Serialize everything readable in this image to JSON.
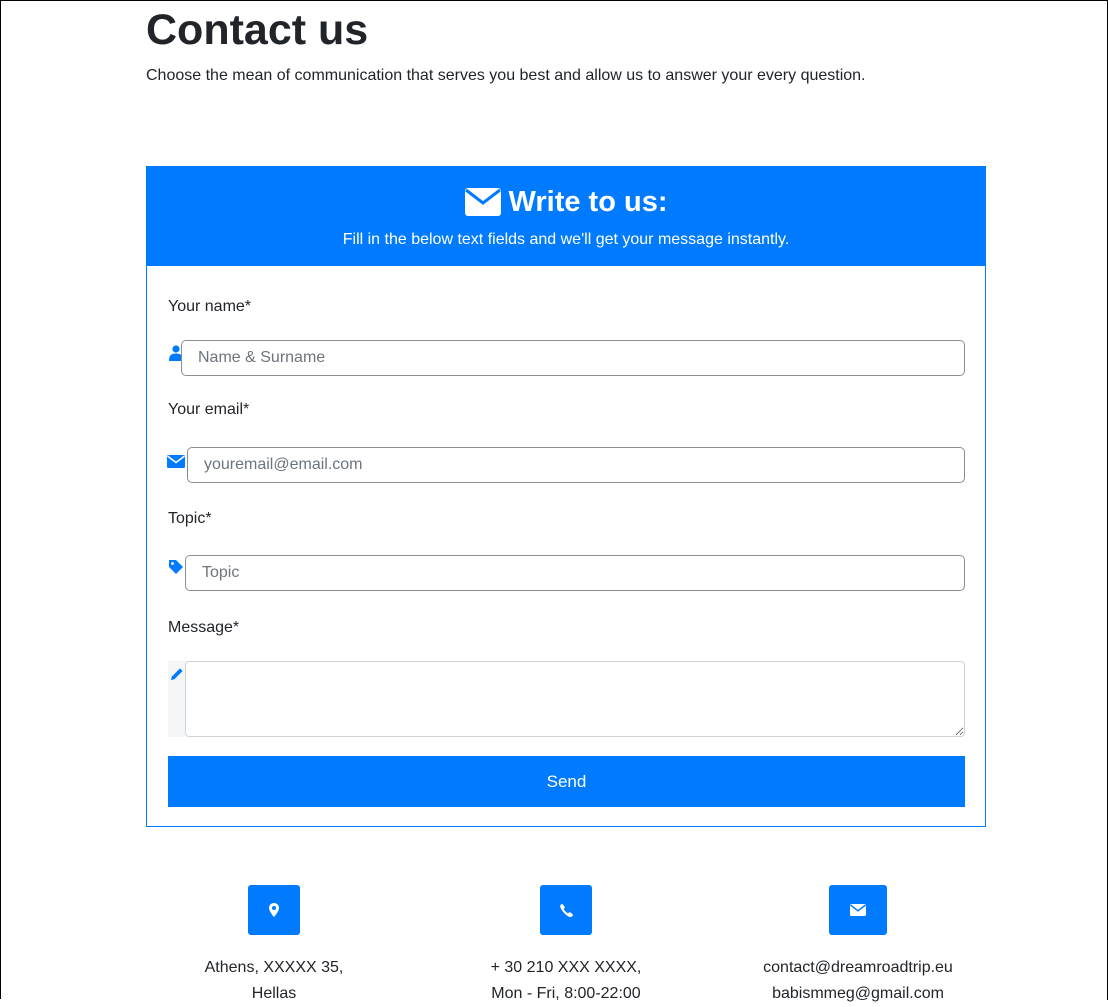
{
  "page": {
    "title": "Contact us",
    "intro": "Choose the mean of communication that serves you best and allow us to answer your every question."
  },
  "form": {
    "title": "Write to us:",
    "subtitle": "Fill in the below text fields and we'll get your message instantly.",
    "header_icon": "envelope-icon",
    "fields": {
      "name": {
        "label": "Your name*",
        "placeholder": "Name & Surname",
        "value": "",
        "icon": "user-icon"
      },
      "email": {
        "label": "Your email*",
        "placeholder": "youremail@email.com",
        "value": "",
        "icon": "envelope-icon"
      },
      "topic": {
        "label": "Topic*",
        "placeholder": "Topic",
        "value": "",
        "icon": "tag-icon"
      },
      "message": {
        "label": "Message*",
        "placeholder": "",
        "value": "",
        "icon": "pencil-icon"
      }
    },
    "send_label": "Send"
  },
  "contact_info": {
    "address": {
      "icon": "map-marker-icon",
      "line1": "Athens, XXXXX 35,",
      "line2": "Hellas"
    },
    "phone": {
      "icon": "phone-icon",
      "line1": "+ 30 210 XXX XXXX,",
      "line2": "Mon - Fri, 8:00-22:00"
    },
    "email": {
      "icon": "envelope-icon",
      "line1": "contact@dreamroadtrip.eu",
      "line2": "babismmeg@gmail.com"
    }
  },
  "colors": {
    "accent": "#007bff",
    "text": "#212529",
    "background": "#ffffff"
  }
}
